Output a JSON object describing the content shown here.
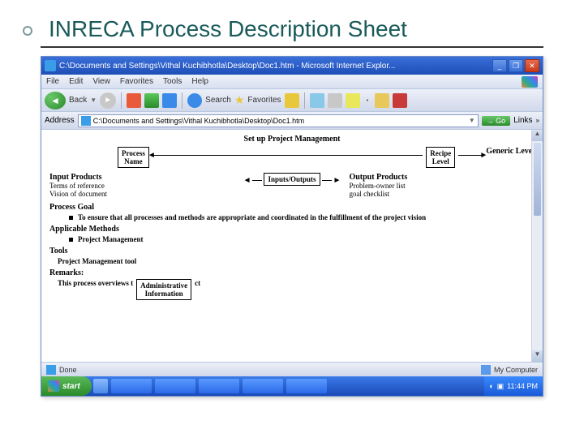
{
  "slide": {
    "title": "INRECA Process Description Sheet"
  },
  "window": {
    "title": "C:\\Documents and Settings\\Vithal Kuchibhotla\\Desktop\\Doc1.htm - Microsoft Internet Explor..."
  },
  "menubar": {
    "file": "File",
    "edit": "Edit",
    "view": "View",
    "favorites": "Favorites",
    "tools": "Tools",
    "help": "Help"
  },
  "toolbar": {
    "back": "Back",
    "search": "Search",
    "favorites": "Favorites"
  },
  "addrbar": {
    "label": "Address",
    "value": "C:\\Documents and Settings\\Vithal Kuchibhotla\\Desktop\\Doc1.htm",
    "go": "Go",
    "links": "Links"
  },
  "doc": {
    "title_center": "Set up Project Management",
    "process_name": "Process\nName",
    "recipe_level": "Recipe\nLevel",
    "generic_level": "Generic Level",
    "inputs_box": "Inputs/Outputs",
    "input_products_h": "Input Products",
    "input_products_1": "Terms of reference",
    "input_products_2": "Vision of document",
    "output_products_h": "Output Products",
    "output_products_1": "Problem-owner list",
    "output_products_2": "goal checklist",
    "process_goal_h": "Process Goal",
    "process_goal_b": "To ensure that all processes and methods are appropriate and coordinated in the fulfillment of the project vision",
    "methods_h": "Applicable Methods",
    "methods_b": "Project Management",
    "tools_h": "Tools",
    "tools_b": "Project Management tool",
    "remarks_h": "Remarks:",
    "remarks_b": "This process overviews t",
    "admin_box": "Administrative\nInformation",
    "remarks_tail": "ct"
  },
  "status": {
    "done": "Done",
    "zone": "My Computer"
  },
  "taskbar": {
    "start": "start",
    "clock": "11:44 PM"
  }
}
